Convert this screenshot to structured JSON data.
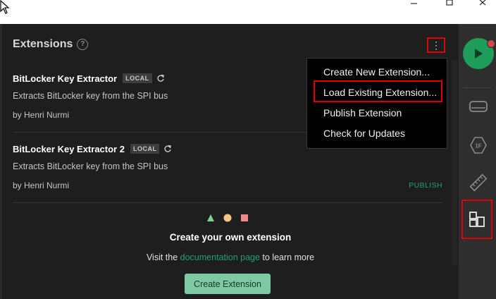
{
  "header": {
    "title": "Extensions",
    "help_symbol": "?"
  },
  "menu_trigger": {
    "symbol": "⋮"
  },
  "extensions": [
    {
      "name": "BitLocker Key Extractor",
      "badge": "LOCAL",
      "description": "Extracts BitLocker key from the SPI bus",
      "author": "by Henri Nurmi",
      "action": ""
    },
    {
      "name": "BitLocker Key Extractor 2",
      "badge": "LOCAL",
      "description": "Extracts BitLocker key from the SPI bus",
      "author": "by Henri Nurmi",
      "action": "PUBLISH"
    }
  ],
  "cta": {
    "title": "Create your own extension",
    "text_before": "Visit the ",
    "link": "documentation page",
    "text_after": " to learn more",
    "button": "Create Extension"
  },
  "menu": {
    "items": [
      "Create New Extension...",
      "Load Existing Extension...",
      "Publish Extension",
      "Check for Updates"
    ],
    "highlighted_index": 1
  },
  "sidebar": {
    "icons": [
      "run-icon",
      "device-icon",
      "1f-icon",
      "ruler-icon",
      "extensions-icon"
    ],
    "label_1f": "1F"
  },
  "colors": {
    "panel": "#1e1e1e",
    "menu": "#000000",
    "accent_green": "#22a06b",
    "button_green": "#7ec8a4",
    "highlight_red": "#e00000",
    "run_green": "#1f9d5b"
  }
}
